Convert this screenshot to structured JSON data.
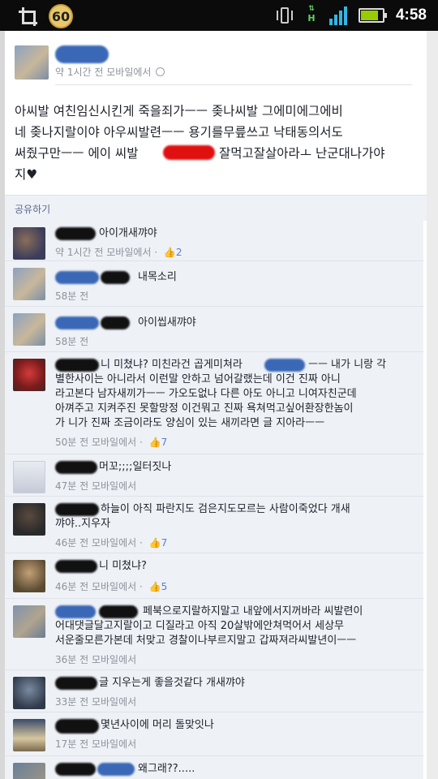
{
  "status_bar": {
    "badge": "60",
    "network_badge": "H",
    "time": "4:58",
    "battery_level": 0.8,
    "signal_level": 4,
    "colors": {
      "signal": "#33b5e5",
      "battery": "#99cc00"
    }
  },
  "post": {
    "meta": "약 1시간 전 모바일에서",
    "lines": [
      "아씨발 여친임신시킨게 죽을죄가ㅡㅡ 좆나씨발 그에미에그에비",
      "네 좆나지랄이야 아우씨발련ㅡㅡ 용기를무릎쓰고 낙태동의서도",
      "써줬구만ㅡㅡ 에이 씨발",
      "잘먹고잘살아라ㅗ 난군대나가야",
      "지♥"
    ]
  },
  "share": {
    "label": "공유하기"
  },
  "comments": [
    {
      "text": [
        "아이개새꺄야"
      ],
      "meta": "약 1시간 전 모바일에서",
      "likes": "2"
    },
    {
      "text": [
        "내목소리"
      ],
      "meta": "58분 전",
      "likes": ""
    },
    {
      "text": [
        "아이씹새꺄야"
      ],
      "meta": "58분 전",
      "likes": ""
    },
    {
      "text": [
        "니 미쳤냐? 미친라건 곱게미쳐라",
        "ㅡㅡ 내가 니랑 각",
        "별한사이는 아니라서 이런말 안하고 넘어갈랬는데 이건 진짜 아니",
        "라고본다 남자새끼가ㅡㅡ 가오도없나 다른 아도 아니고 니여자친군데",
        "아껴주고 지켜주진 못할망정 이건뭐고 진짜 욕쳐먹고싶어환장한놈이",
        "가 니가 진짜 조금이라도 양심이 있는 새끼라면 글 지아라ㅡㅡ"
      ],
      "meta": "50분 전 모바일에서",
      "likes": "7"
    },
    {
      "text": [
        "머꼬;;;;일터짓나"
      ],
      "meta": "47분 전 모바일에서",
      "likes": ""
    },
    {
      "text": [
        "하늘이 아직 파란지도 검은지도모르는 사람이죽었다 개새",
        "꺄야..지우자"
      ],
      "meta": "46분 전 모바일에서",
      "likes": "7"
    },
    {
      "text": [
        "니 미쳤냐?"
      ],
      "meta": "46분 전 모바일에서",
      "likes": "5"
    },
    {
      "text": [
        "페북으로지랄하지말고 내앞에서지꺼바라 씨발련이",
        "어대댓글달고지랄이고 디질라고 아직 20살밖에안쳐먹어서 세상무",
        "서운줄모른가본데 처맞고 경찰이나부르지말고 갑짜져라씨발년이ㅡㅡ"
      ],
      "meta": "36분 전 모바일에서",
      "likes": ""
    },
    {
      "text": [
        "글 지우는게 좋을것같다 개새꺄야"
      ],
      "meta": "33분 전 모바일에서",
      "likes": ""
    },
    {
      "text": [
        "몇년사이에 머리 돌맞잇나"
      ],
      "meta": "17분 전 모바일에서",
      "likes": ""
    },
    {
      "text": [
        "왜그래??....."
      ],
      "meta": "",
      "likes": ""
    }
  ]
}
